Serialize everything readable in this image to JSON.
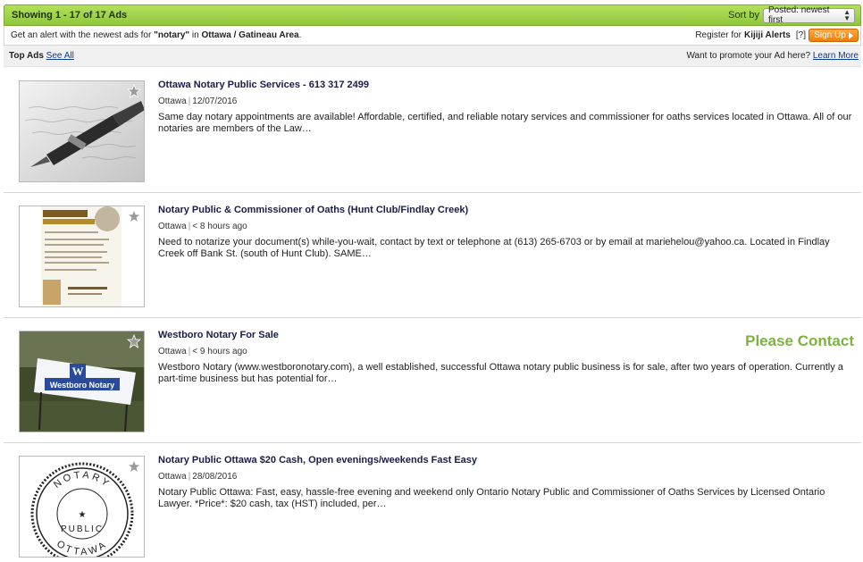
{
  "results": {
    "count_label": "Showing 1 - 17 of 17 Ads",
    "sort_label": "Sort by",
    "sort_value": "Posted: newest first"
  },
  "alert": {
    "prefix": "Get an alert with the newest ads for ",
    "query": "\"notary\"",
    "middle": " in ",
    "area": "Ottawa / Gatineau Area",
    "suffix": ".",
    "register_text": "Register for ",
    "brand": "Kijiji Alerts",
    "help": "[?]",
    "signup_label": "Sign Up"
  },
  "topads": {
    "label": "Top Ads",
    "see_all": "See All",
    "promote_text": "Want to promote your Ad here?",
    "learn_more": "Learn More"
  },
  "ads": [
    {
      "title": "Ottawa Notary Public Services - 613 317 2499",
      "location": "Ottawa",
      "date": "12/07/2016",
      "description": "Same day notary appointments are available! Affordable, certified, and reliable notary services and commissioner for oaths services located in Ottawa. All of our notaries are members of the Law…",
      "badge": "",
      "image": "fountain-pen-photo"
    },
    {
      "title": "Notary Public & Commissioner of Oaths (Hunt Club/Findlay Creek)",
      "location": "Ottawa",
      "date": "< 8 hours ago",
      "description": "Need to notarize your document(s) while-you-wait, contact by text or telephone at (613) 265-6703 or by email at mariehelou@yahoo.ca. Located in Findlay Creek off Bank St. (south of Hunt Club). SAME…",
      "badge": "",
      "image": "flyer-photo"
    },
    {
      "title": "Westboro Notary For Sale",
      "location": "Ottawa",
      "date": "< 9 hours ago",
      "description": "Westboro Notary (www.westboronotary.com), a well established, successful Ottawa notary public business is for sale, after two years of operation. Currently a part-time business but has potential for…",
      "badge": "Please Contact",
      "image": "westboro-sign-photo",
      "sign_text": "Westboro Notary",
      "sign_logo": "W"
    },
    {
      "title": "Notary Public Ottawa $20 Cash, Open evenings/weekends Fast Easy",
      "location": "Ottawa",
      "date": "28/08/2016",
      "description": "Notary Public Ottawa: Fast, easy, hassle-free evening and weekend only Ontario Notary Public and Commissioner of Oaths Services by Licensed Ontario Lawyer. *Price*: $20 cash, tax (HST) included, per…",
      "badge": "",
      "image": "notary-stamp-image",
      "stamp_text_top": "NOTARY",
      "stamp_text_mid": "PUBLIC",
      "stamp_text_bottom": "OTTAWA"
    }
  ],
  "colors": {
    "accent_green": "#8fc73e",
    "badge_green": "#7cb342",
    "signup_orange": "#f07d09",
    "link_blue": "#0b3b8c",
    "title_navy": "#1a1d47"
  }
}
